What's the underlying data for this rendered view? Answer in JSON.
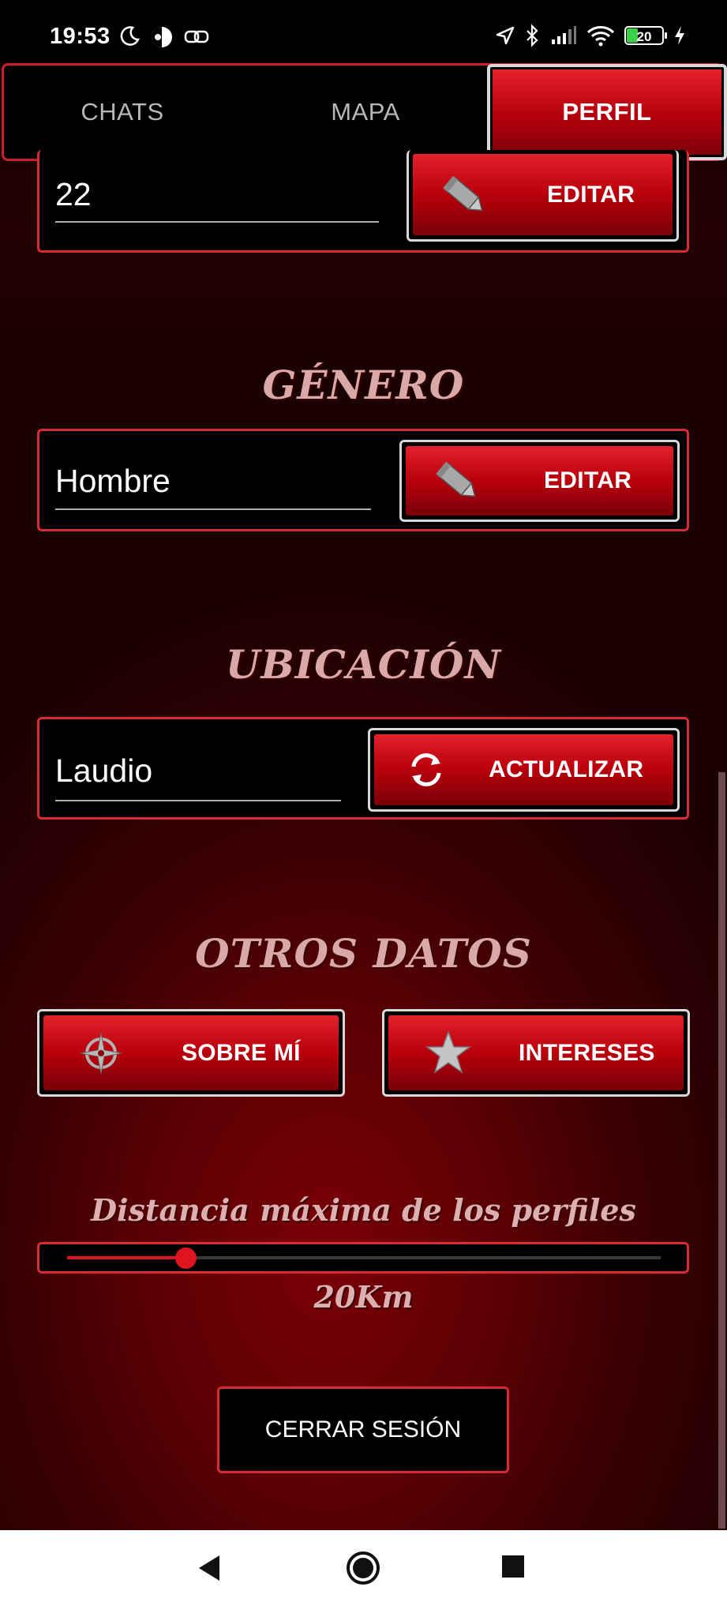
{
  "status_bar": {
    "time": "19:53",
    "battery": "20",
    "left_icons": [
      "moon-icon",
      "contrast-icon",
      "link-icon"
    ],
    "right_icons": [
      "location-arrow-icon",
      "bluetooth-icon",
      "signal-icon",
      "wifi-icon",
      "battery-icon",
      "charging-icon"
    ]
  },
  "tabs": [
    {
      "label": "CHATS",
      "active": false
    },
    {
      "label": "MAPA",
      "active": false
    },
    {
      "label": "PERFIL",
      "active": true
    }
  ],
  "age_field": {
    "value": "22",
    "button_label": "EDITAR",
    "icon": "pencil-icon"
  },
  "gender_section": {
    "title": "GÉNERO",
    "value": "Hombre",
    "button_label": "EDITAR",
    "icon": "pencil-icon"
  },
  "location_section": {
    "title": "UBICACIÓN",
    "value": "Laudio",
    "button_label": "ACTUALIZAR",
    "icon": "refresh-icon"
  },
  "other_section": {
    "title": "OTROS DATOS",
    "about_label": "SOBRE MÍ",
    "about_icon": "compass-icon",
    "interests_label": "INTERESES",
    "interests_icon": "star-icon"
  },
  "distance": {
    "title": "Distancia máxima de los perfiles",
    "value_label": "20Km",
    "fraction": 0.2
  },
  "logout_label": "CERRAR SESIÓN",
  "nav": [
    "back-icon",
    "home-icon",
    "recents-icon"
  ],
  "colors": {
    "accent": "#d82c34",
    "button_red": "#b8000c",
    "title": "#d9a8a8"
  }
}
